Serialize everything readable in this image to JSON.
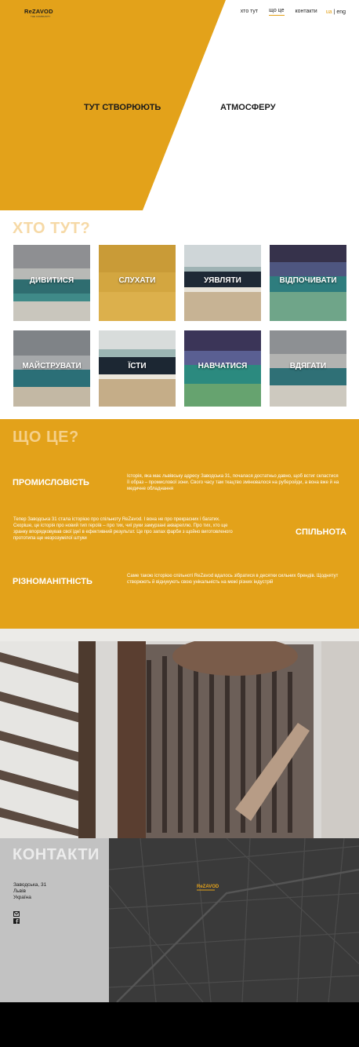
{
  "header": {
    "logo_main": "ReZAVOD",
    "logo_sub": "THE COMMUNITY",
    "nav": [
      "хто тут",
      "що це",
      "контакти"
    ],
    "active_nav_index": 1,
    "lang_ua": "ua",
    "lang_sep": "|",
    "lang_en": "eng"
  },
  "hero": {
    "left_text": "ТУТ СТВОРЮЮТЬ",
    "right_text": "АТМОСФЕРУ",
    "accent_color": "#e3a21a"
  },
  "who": {
    "title": "ХТО ТУТ?",
    "tiles": [
      {
        "label": "ДИВИТИСЯ"
      },
      {
        "label": "СЛУХАТИ"
      },
      {
        "label": "УЯВЛЯТИ"
      },
      {
        "label": "ВІДПОЧИВАТИ"
      },
      {
        "label": "МАЙСТРУВАТИ"
      },
      {
        "label": "ЇСТИ"
      },
      {
        "label": "НАВЧАТИСЯ"
      },
      {
        "label": "ВДЯГАТИ"
      }
    ]
  },
  "what": {
    "title": "ЩО ЦЕ?",
    "blocks": [
      {
        "heading": "ПРОМИСЛОВІСТЬ",
        "text": "Історія, яка має львівську адресу Заводська 31, почалася достатньо давно, щоб встиг скластися її образ – промислової зони. Свого часу там ткацтво змінювалося на руберойди, а вона вже й на медичне обладнання"
      },
      {
        "heading": "СПІЛЬНОТА",
        "text": "Тепер Заводська 31 стала історією про спільноту ReZavod. І вона не про прекрасних і багатих. Скоріше, це історія про новий тип героїв – про тих, чиї руки замурзані аквареллю. Про тих, хто ще зранку впорядковував свої ідеї в ефективний результат. Це про запах фарби з щойно виготовленого прототипа ще незрозумілої штуки"
      },
      {
        "heading": "РІЗНОМАНІТНІСТЬ",
        "text": "Саме такою історією спільноті ReZavod вдалось зібратися в десятки сильних брендів. Щоднятут створюють й віднукують свою унікальність на межі різних індустрій"
      }
    ]
  },
  "contacts": {
    "title": "КОНТАКТИ",
    "address_lines": [
      "Заводська, 31",
      "Львів",
      "Україна"
    ],
    "icons": [
      "mail-icon",
      "facebook-icon"
    ],
    "map_logo": "ReZAVOD"
  }
}
